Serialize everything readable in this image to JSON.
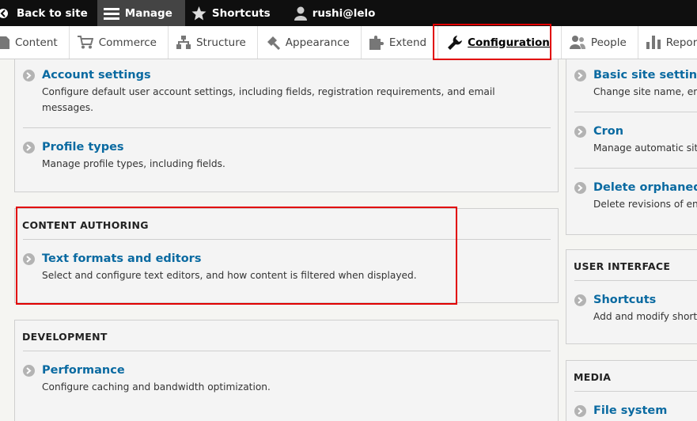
{
  "toolbar": {
    "back_label": "Back to site",
    "manage_label": "Manage",
    "shortcuts_label": "Shortcuts",
    "user_label": "rushi@lelo"
  },
  "tray": {
    "items": [
      {
        "label": "Content",
        "icon": "page-icon"
      },
      {
        "label": "Commerce",
        "icon": "cart-icon"
      },
      {
        "label": "Structure",
        "icon": "sitemap-icon"
      },
      {
        "label": "Appearance",
        "icon": "paintbrush-icon"
      },
      {
        "label": "Extend",
        "icon": "puzzle-icon"
      },
      {
        "label": "Configuration",
        "icon": "wrench-icon",
        "active": true
      },
      {
        "label": "People",
        "icon": "people-icon"
      },
      {
        "label": "Reports",
        "icon": "bar-chart-icon"
      }
    ]
  },
  "left": {
    "people_section": {
      "items": [
        {
          "title": "Account settings",
          "desc": "Configure default user account settings, including fields, registration requirements, and email\nmessages."
        },
        {
          "title": "Profile types",
          "desc": "Manage profile types, including fields."
        }
      ]
    },
    "content_authoring": {
      "heading": "CONTENT AUTHORING",
      "items": [
        {
          "title": "Text formats and editors",
          "desc": "Select and configure text editors, and how content is filtered when displayed."
        }
      ]
    },
    "development": {
      "heading": "DEVELOPMENT",
      "items": [
        {
          "title": "Performance",
          "desc": "Configure caching and bandwidth optimization."
        }
      ]
    }
  },
  "right": {
    "system": {
      "items": [
        {
          "title": "Basic site settings",
          "desc": "Change site name, em"
        },
        {
          "title": "Cron",
          "desc": "Manage automatic site"
        },
        {
          "title": "Delete orphaned c",
          "desc": "Delete revisions of ent"
        }
      ]
    },
    "user_interface": {
      "heading": "USER INTERFACE",
      "items": [
        {
          "title": "Shortcuts",
          "desc": "Add and modify short"
        }
      ]
    },
    "media": {
      "heading": "MEDIA",
      "items": [
        {
          "title": "File system",
          "desc": ""
        }
      ]
    }
  },
  "colors": {
    "link": "#0a6aa1",
    "highlight": "#e10000",
    "toolbar": "#0f0f0f"
  }
}
